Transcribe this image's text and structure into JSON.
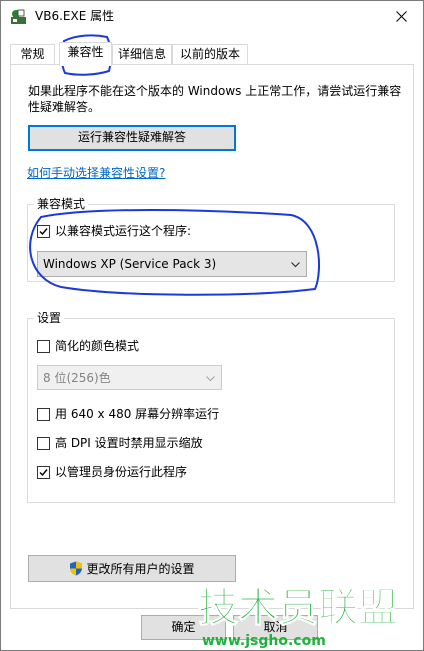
{
  "window": {
    "title": "VB6.EXE 属性"
  },
  "tabs": [
    {
      "label": "常规"
    },
    {
      "label": "兼容性"
    },
    {
      "label": "详细信息"
    },
    {
      "label": "以前的版本"
    }
  ],
  "compat": {
    "intro": "如果此程序不能在这个版本的 Windows 上正常工作，请尝试运行兼容性疑难解答。",
    "troubleshoot_label": "运行兼容性疑难解答",
    "manual_link": "如何手动选择兼容性设置?",
    "mode_group": {
      "title": "兼容模式",
      "checkbox_label": "以兼容模式运行这个程序:",
      "checked": true,
      "selected_os": "Windows XP (Service Pack 3)"
    },
    "settings_group": {
      "title": "设置",
      "reduced_color_label": "简化的颜色模式",
      "color_mode_value": "8 位(256)色",
      "res640_label": "用 640 x 480 屏幕分辨率运行",
      "dpi_label": "高 DPI 设置时禁用显示缩放",
      "admin_label": "以管理员身份运行此程序"
    },
    "change_all_label": "更改所有用户的设置"
  },
  "footer": {
    "ok_label": "确定",
    "cancel_label": "取消"
  },
  "watermark": {
    "text": "技术员联盟",
    "url": "www.jsgho.com"
  },
  "colors": {
    "accent": "#0078d7",
    "link": "#0066cc",
    "annotation": "#1a3adb",
    "watermark_green": "#1fb23a"
  }
}
